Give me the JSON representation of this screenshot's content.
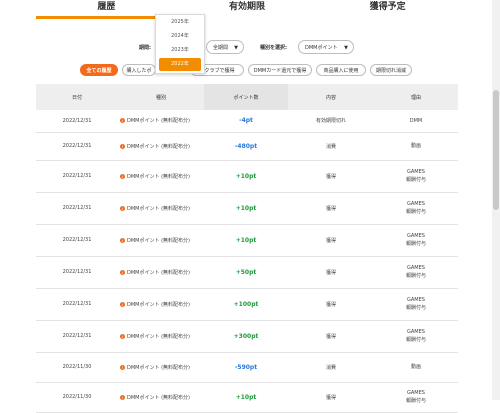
{
  "tabs": [
    {
      "label": "履歴",
      "active": true
    },
    {
      "label": "有効期限",
      "active": false
    },
    {
      "label": "獲得予定",
      "active": false
    }
  ],
  "filters": {
    "period_label": "期間:",
    "year_options": [
      "2025年",
      "2024年",
      "2023年",
      "2022年"
    ],
    "year_selected": "2022年",
    "scope_value": "全期間",
    "kind_label": "種別を選択:",
    "kind_value": "DMMポイント"
  },
  "chips": [
    {
      "label": "全ての履歴",
      "active": true
    },
    {
      "label": "購入したポ",
      "active": false
    },
    {
      "label": "…クラブで獲得",
      "active": false
    },
    {
      "label": "DMMカード還元で獲得",
      "active": false
    },
    {
      "label": "商品購入に使用",
      "active": false
    },
    {
      "label": "期限切れ消滅",
      "active": false
    }
  ],
  "table": {
    "headers": [
      "日付",
      "種別",
      "ポイント数",
      "内容",
      "理由"
    ],
    "rows": [
      {
        "date": "2022/12/31",
        "type": "DMMポイント (無料配布分)",
        "points": "-4pt",
        "sign": "neg",
        "content": "有効期限切れ",
        "reason": [
          "DMM"
        ]
      },
      {
        "date": "2022/12/31",
        "type": "DMMポイント (無料配布分)",
        "points": "-480pt",
        "sign": "neg",
        "content": "消費",
        "reason": [
          "動画"
        ]
      },
      {
        "date": "2022/12/31",
        "type": "DMMポイント (無料配布分)",
        "points": "+10pt",
        "sign": "pos",
        "content": "獲得",
        "reason": [
          "GAMES",
          "報酬付与"
        ]
      },
      {
        "date": "2022/12/31",
        "type": "DMMポイント (無料配布分)",
        "points": "+10pt",
        "sign": "pos",
        "content": "獲得",
        "reason": [
          "GAMES",
          "報酬付与"
        ]
      },
      {
        "date": "2022/12/31",
        "type": "DMMポイント (無料配布分)",
        "points": "+10pt",
        "sign": "pos",
        "content": "獲得",
        "reason": [
          "GAMES",
          "報酬付与"
        ]
      },
      {
        "date": "2022/12/31",
        "type": "DMMポイント (無料配布分)",
        "points": "+50pt",
        "sign": "pos",
        "content": "獲得",
        "reason": [
          "GAMES",
          "報酬付与"
        ]
      },
      {
        "date": "2022/12/31",
        "type": "DMMポイント (無料配布分)",
        "points": "+100pt",
        "sign": "pos",
        "content": "獲得",
        "reason": [
          "GAMES",
          "報酬付与"
        ]
      },
      {
        "date": "2022/12/31",
        "type": "DMMポイント (無料配布分)",
        "points": "+300pt",
        "sign": "pos",
        "content": "獲得",
        "reason": [
          "GAMES",
          "報酬付与"
        ]
      },
      {
        "date": "2022/11/30",
        "type": "DMMポイント (無料配布分)",
        "points": "-590pt",
        "sign": "neg",
        "content": "消費",
        "reason": [
          "動画"
        ]
      },
      {
        "date": "2022/11/30",
        "type": "DMMポイント (無料配布分)",
        "points": "+10pt",
        "sign": "pos",
        "content": "獲得",
        "reason": [
          "GAMES",
          "報酬付与"
        ]
      }
    ]
  },
  "icons": {
    "info": "info-icon",
    "caret": "caret-down-icon"
  },
  "colors": {
    "accent": "#f28c00",
    "chip_active": "#f26a1b",
    "positive": "#1a9a3a",
    "negative": "#2677d9"
  }
}
